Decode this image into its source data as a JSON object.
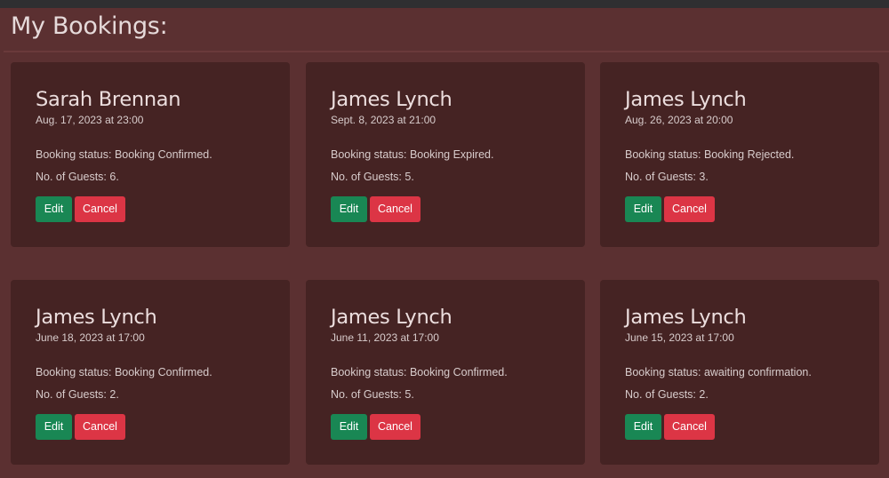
{
  "page": {
    "title": "My Bookings:"
  },
  "colors": {
    "background": "#5b3031",
    "card": "#452323",
    "topbar": "#2f2f31",
    "edit_button": "#198754",
    "cancel_button": "#dc3545"
  },
  "bookings": [
    {
      "name": "Sarah Brennan",
      "datetime": "Aug. 17, 2023 at 23:00",
      "status": "Booking status: Booking Confirmed.",
      "guests": "No. of Guests: 6.",
      "edit_label": "Edit",
      "cancel_label": "Cancel"
    },
    {
      "name": "James Lynch",
      "datetime": "Sept. 8, 2023 at 21:00",
      "status": "Booking status: Booking Expired.",
      "guests": "No. of Guests: 5.",
      "edit_label": "Edit",
      "cancel_label": "Cancel"
    },
    {
      "name": "James Lynch",
      "datetime": "Aug. 26, 2023 at 20:00",
      "status": "Booking status: Booking Rejected.",
      "guests": "No. of Guests: 3.",
      "edit_label": "Edit",
      "cancel_label": "Cancel"
    },
    {
      "name": "James Lynch",
      "datetime": "June 18, 2023 at 17:00",
      "status": "Booking status: Booking Confirmed.",
      "guests": "No. of Guests: 2.",
      "edit_label": "Edit",
      "cancel_label": "Cancel"
    },
    {
      "name": "James Lynch",
      "datetime": "June 11, 2023 at 17:00",
      "status": "Booking status: Booking Confirmed.",
      "guests": "No. of Guests: 5.",
      "edit_label": "Edit",
      "cancel_label": "Cancel"
    },
    {
      "name": "James Lynch",
      "datetime": "June 15, 2023 at 17:00",
      "status": "Booking status: awaiting confirmation.",
      "guests": "No. of Guests: 2.",
      "edit_label": "Edit",
      "cancel_label": "Cancel"
    }
  ]
}
